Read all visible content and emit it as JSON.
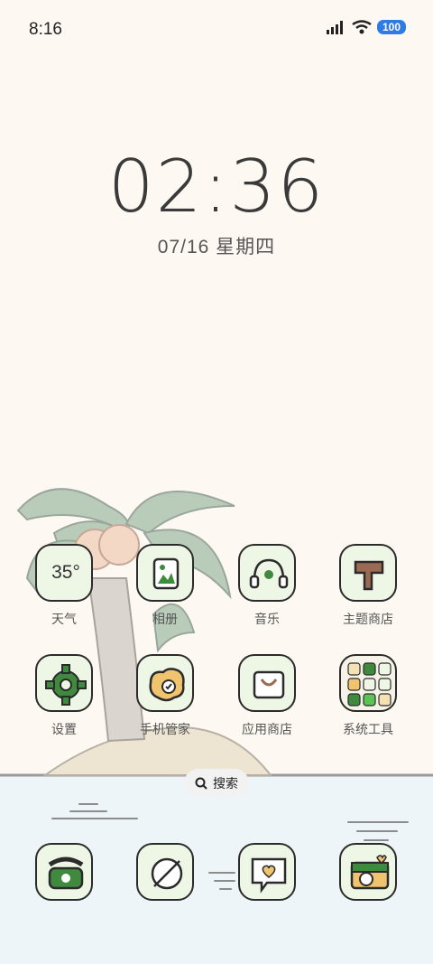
{
  "status": {
    "time": "8:16",
    "battery": "100"
  },
  "clock": {
    "time": "02:36",
    "date": "07/16 星期四"
  },
  "apps": [
    {
      "label": "天气",
      "icon": "weather-icon",
      "temp": "35°"
    },
    {
      "label": "相册",
      "icon": "gallery-icon"
    },
    {
      "label": "音乐",
      "icon": "music-icon"
    },
    {
      "label": "主题商店",
      "icon": "theme-store-icon"
    },
    {
      "label": "设置",
      "icon": "settings-icon"
    },
    {
      "label": "手机管家",
      "icon": "phone-manager-icon"
    },
    {
      "label": "应用商店",
      "icon": "app-store-icon"
    },
    {
      "label": "系统工具",
      "icon": "system-tools-folder-icon"
    }
  ],
  "search": {
    "label": "搜索"
  },
  "dock": [
    {
      "icon": "phone-icon"
    },
    {
      "icon": "browser-icon"
    },
    {
      "icon": "messages-icon"
    },
    {
      "icon": "camera-icon"
    }
  ]
}
